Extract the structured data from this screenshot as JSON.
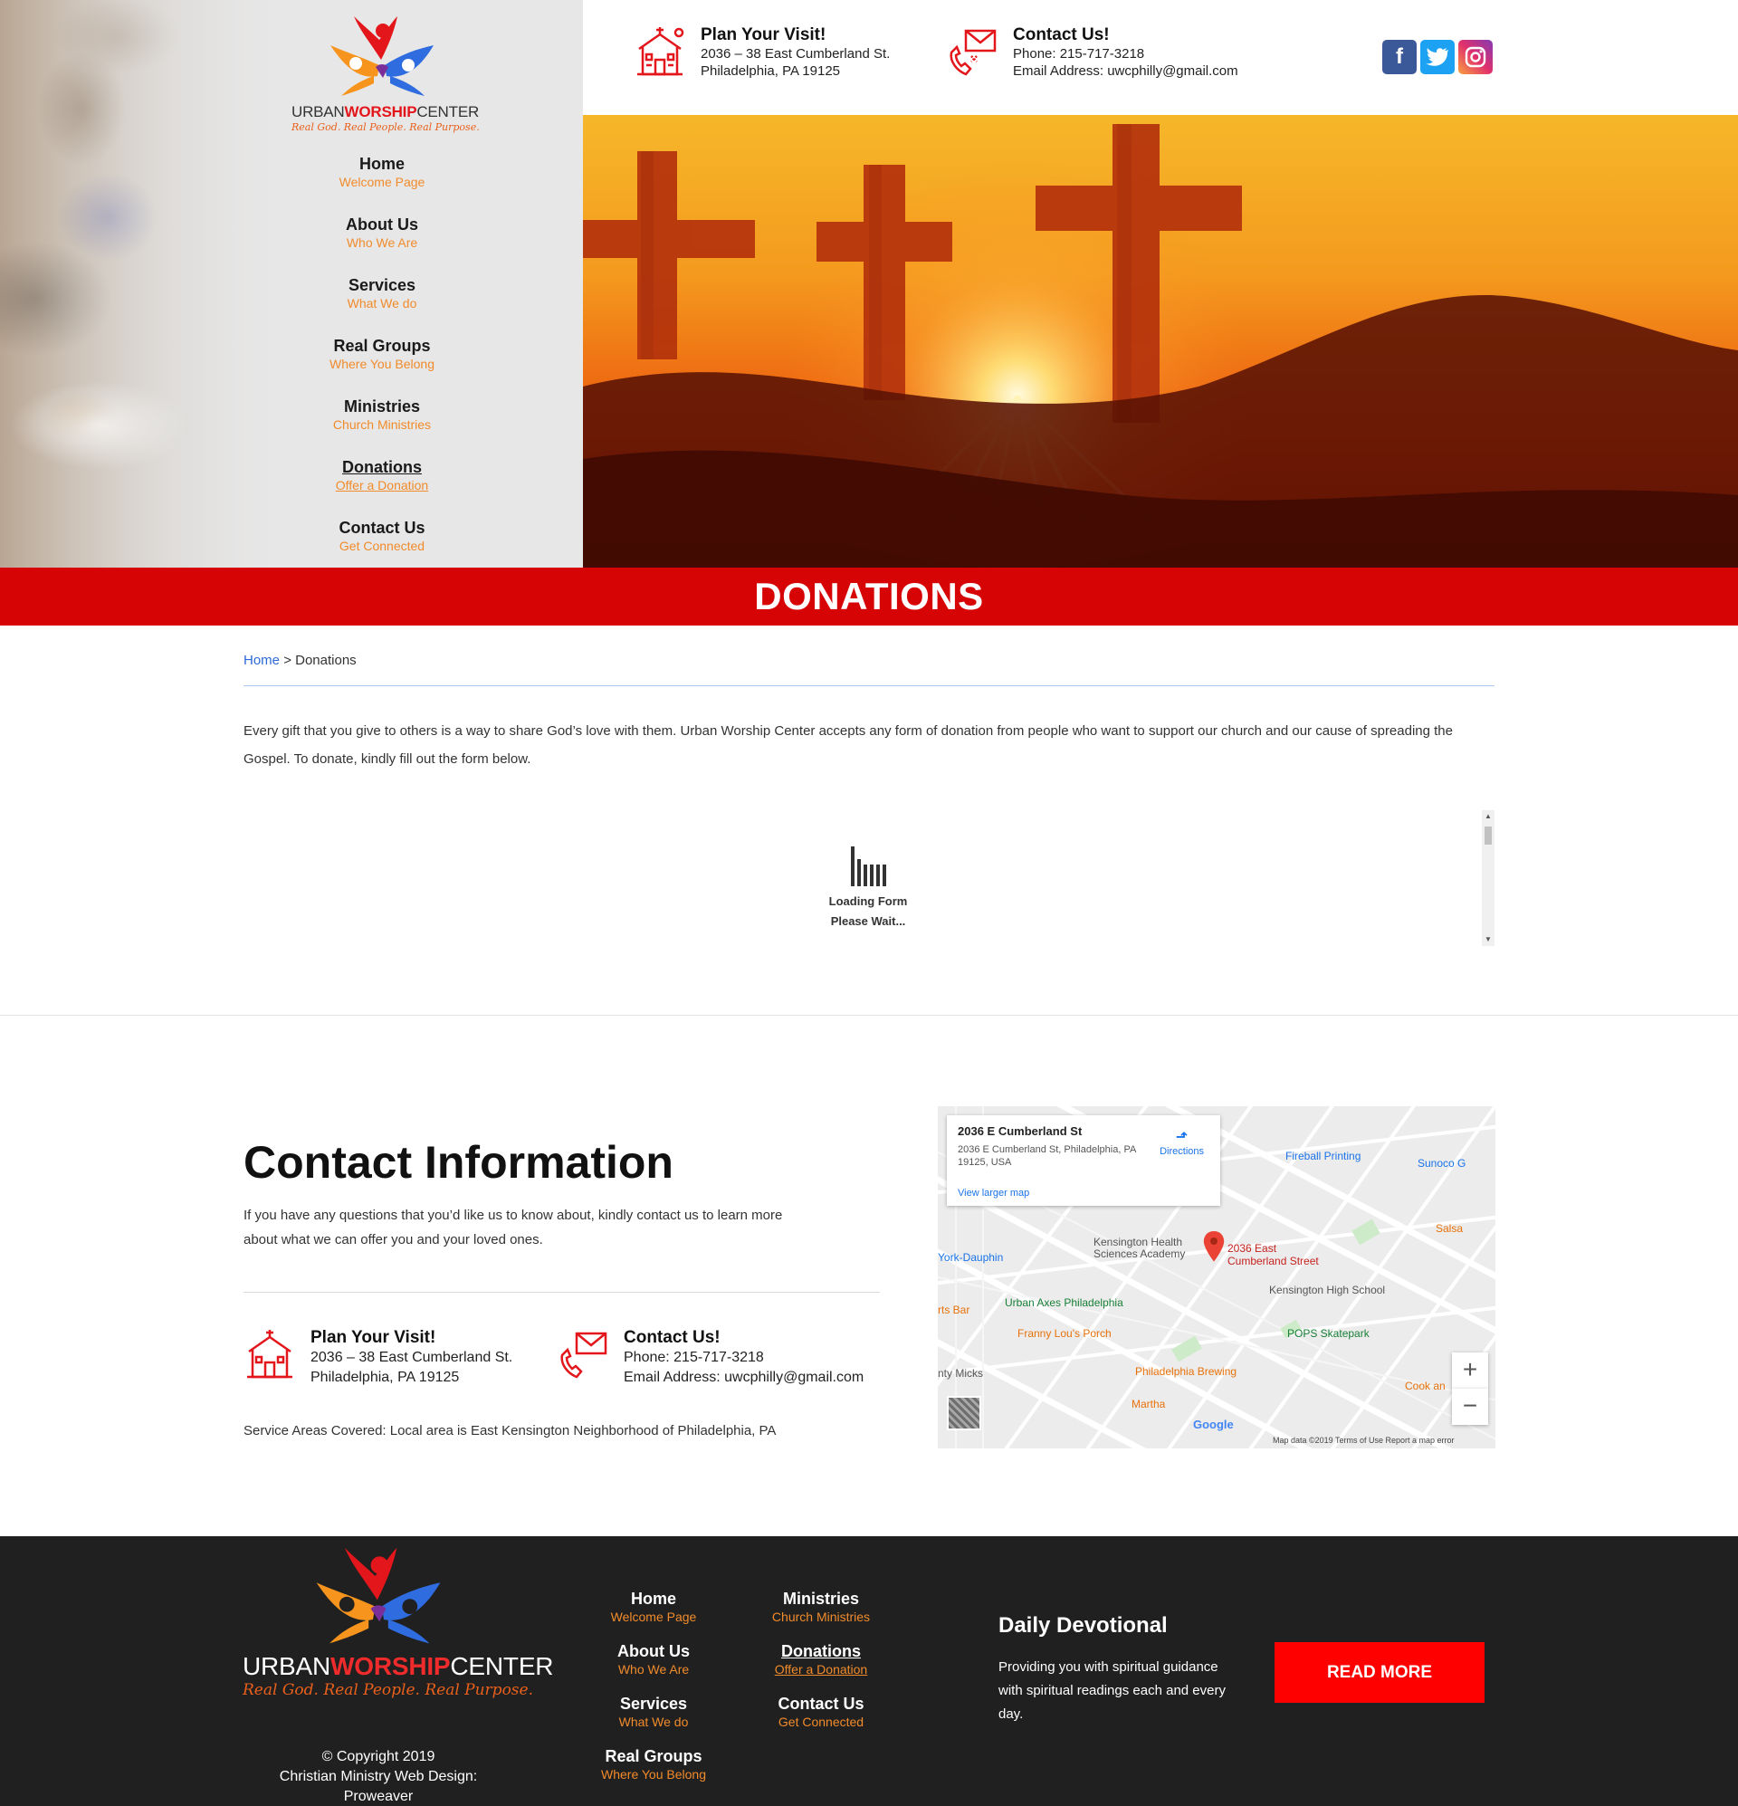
{
  "brand": {
    "name_part1": "URBAN",
    "name_part2": "WORSHIP",
    "name_part3": "CENTER",
    "tagline": "Real God. Real People. Real Purpose.",
    "colors": {
      "red": "#d60404",
      "orange": "#f18b2b",
      "blue": "#2d6ad8",
      "dark": "#202020"
    }
  },
  "nav": [
    {
      "title": "Home",
      "subtitle": "Welcome Page"
    },
    {
      "title": "About Us",
      "subtitle": "Who We Are"
    },
    {
      "title": "Services",
      "subtitle": "What We do"
    },
    {
      "title": "Real Groups",
      "subtitle": "Where You Belong"
    },
    {
      "title": "Ministries",
      "subtitle": "Church Ministries"
    },
    {
      "title": "Donations",
      "subtitle": "Offer a Donation",
      "active": true
    },
    {
      "title": "Contact Us",
      "subtitle": "Get Connected"
    }
  ],
  "topbar": {
    "visit": {
      "title": "Plan Your Visit!",
      "line1": "2036 – 38 East Cumberland St.",
      "line2": "Philadelphia, PA 19125",
      "icon": "church-icon"
    },
    "contact": {
      "title": "Contact Us!",
      "phone": "Phone: 215-717-3218",
      "email": "Email Address: uwcphilly@gmail.com",
      "icon": "phone-mail-icon"
    },
    "socials": [
      {
        "name": "facebook-icon",
        "glyph": "f"
      },
      {
        "name": "twitter-icon",
        "glyph": "t"
      },
      {
        "name": "instagram-icon",
        "glyph": "ig"
      }
    ]
  },
  "banner": {
    "title": "DONATIONS"
  },
  "breadcrumb": {
    "home": "Home",
    "separator": ">",
    "current": "Donations"
  },
  "intro": "Every gift that you give to others is a way to share God’s love with them. Urban Worship Center accepts any form of donation from people who want to support our church and our cause of spreading the Gospel. To donate, kindly fill out the form below.",
  "form": {
    "loading_line1": "Loading Form",
    "loading_line2": "Please Wait..."
  },
  "contact_section": {
    "heading": "Contact Information",
    "paragraph": "If you have any questions that you’d like us to know about, kindly contact us to learn more about what we can offer you and your loved ones.",
    "visit": {
      "title": "Plan Your Visit!",
      "line1": "2036 – 38 East Cumberland St.",
      "line2": "Philadelphia, PA 19125"
    },
    "contact": {
      "title": "Contact Us!",
      "phone": "Phone: 215-717-3218",
      "email": "Email Address: uwcphilly@gmail.com"
    },
    "service_areas": "Service Areas Covered: Local area is East Kensington Neighborhood of Philadelphia, PA"
  },
  "map": {
    "place_name": "2036 E Cumberland St",
    "place_address": "2036 E Cumberland St, Philadelphia, PA 19125, USA",
    "directions": "Directions",
    "view_larger": "View larger map",
    "pin_label_line1": "2036 East",
    "pin_label_line2": "Cumberland Street",
    "labels": {
      "fireball": "Fireball Printing",
      "sunoco": "Sunoco G",
      "kensington_health_1": "Kensington Health",
      "kensington_health_2": "Sciences Academy",
      "york_dauphin": "York-Dauphin",
      "salsa": "Salsa",
      "kensington_high": "Kensington High School",
      "urban_axes": "Urban Axes Philadelphia",
      "arts_bar": "rts Bar",
      "franny": "Franny Lou's Porch",
      "pops": "POPS Skatepark",
      "micks": "nty Micks",
      "phila_brewing": "Philadelphia Brewing",
      "cook": "Cook an",
      "martha": "Martha",
      "google": "Google"
    },
    "footer": "Map data ©2019   Terms of Use   Report a map error",
    "zoom_in": "+",
    "zoom_out": "−"
  },
  "footer": {
    "copyright": "© Copyright 2019",
    "credit_line1": "Christian Ministry Web Design:",
    "credit_line2": "Proweaver",
    "devotional_title": "Daily Devotional",
    "devotional_text": "Providing you with spiritual guidance with spiritual readings each and every day.",
    "read_more": "READ MORE"
  }
}
